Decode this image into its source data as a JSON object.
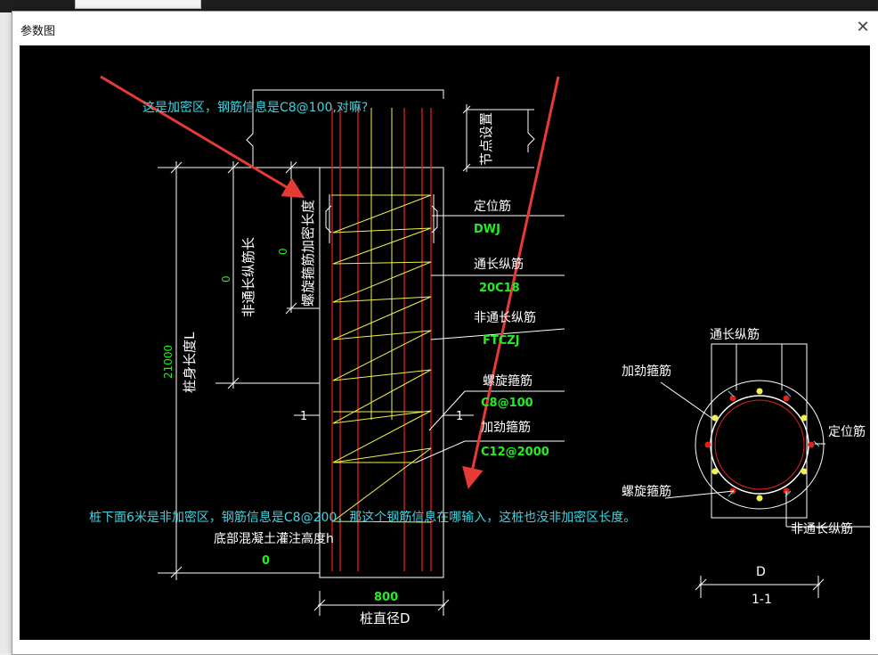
{
  "dialog": {
    "title": "参数图",
    "close_glyph": "✕"
  },
  "annotations": {
    "top_question": "这是加密区，钢筋信息是C8@100,对嘛?",
    "bottom_question": "桩下面6米是非加密区，钢筋信息是C8@200，那这个钢筋信息在哪输入，这桩也没非加密区长度。"
  },
  "elevation": {
    "node_setting": "节点设置",
    "spiral_dense_length": "螺旋箍筋加密长度",
    "spiral_dense_value": "0",
    "non_through_length": "非通长纵筋长",
    "non_through_value": "0",
    "pile_length_label": "桩身长度L",
    "pile_length_value": "21000",
    "positioning_bar": "定位筋",
    "positioning_bar_value": "DWJ",
    "through_bar": "通长纵筋",
    "through_bar_value": "20C18",
    "non_through_bar": "非通长纵筋",
    "non_through_bar_value": "FTCZJ",
    "spiral_stirrup": "螺旋箍筋",
    "spiral_stirrup_value": "C8@100",
    "stiffening_stirrup": "加劲箍筋",
    "stiffening_stirrup_value": "C12@2000",
    "bottom_concrete": "底部混凝土灌注高度h",
    "bottom_concrete_value": "0",
    "diameter_value": "800",
    "diameter_label": "桩直径D",
    "section_mark": "1"
  },
  "section": {
    "through_bar": "通长纵筋",
    "stiffening": "加劲箍筋",
    "positioning": "定位筋",
    "spiral": "螺旋箍筋",
    "non_through": "非通长纵筋",
    "diameter": "D",
    "name": "1-1"
  },
  "colors": {
    "cyan": "#3fd3e0",
    "green": "#22ee22",
    "yellow": "#f2f24a",
    "red": "#e4201a",
    "white": "#ffffff",
    "arrow": "#e83a35"
  }
}
